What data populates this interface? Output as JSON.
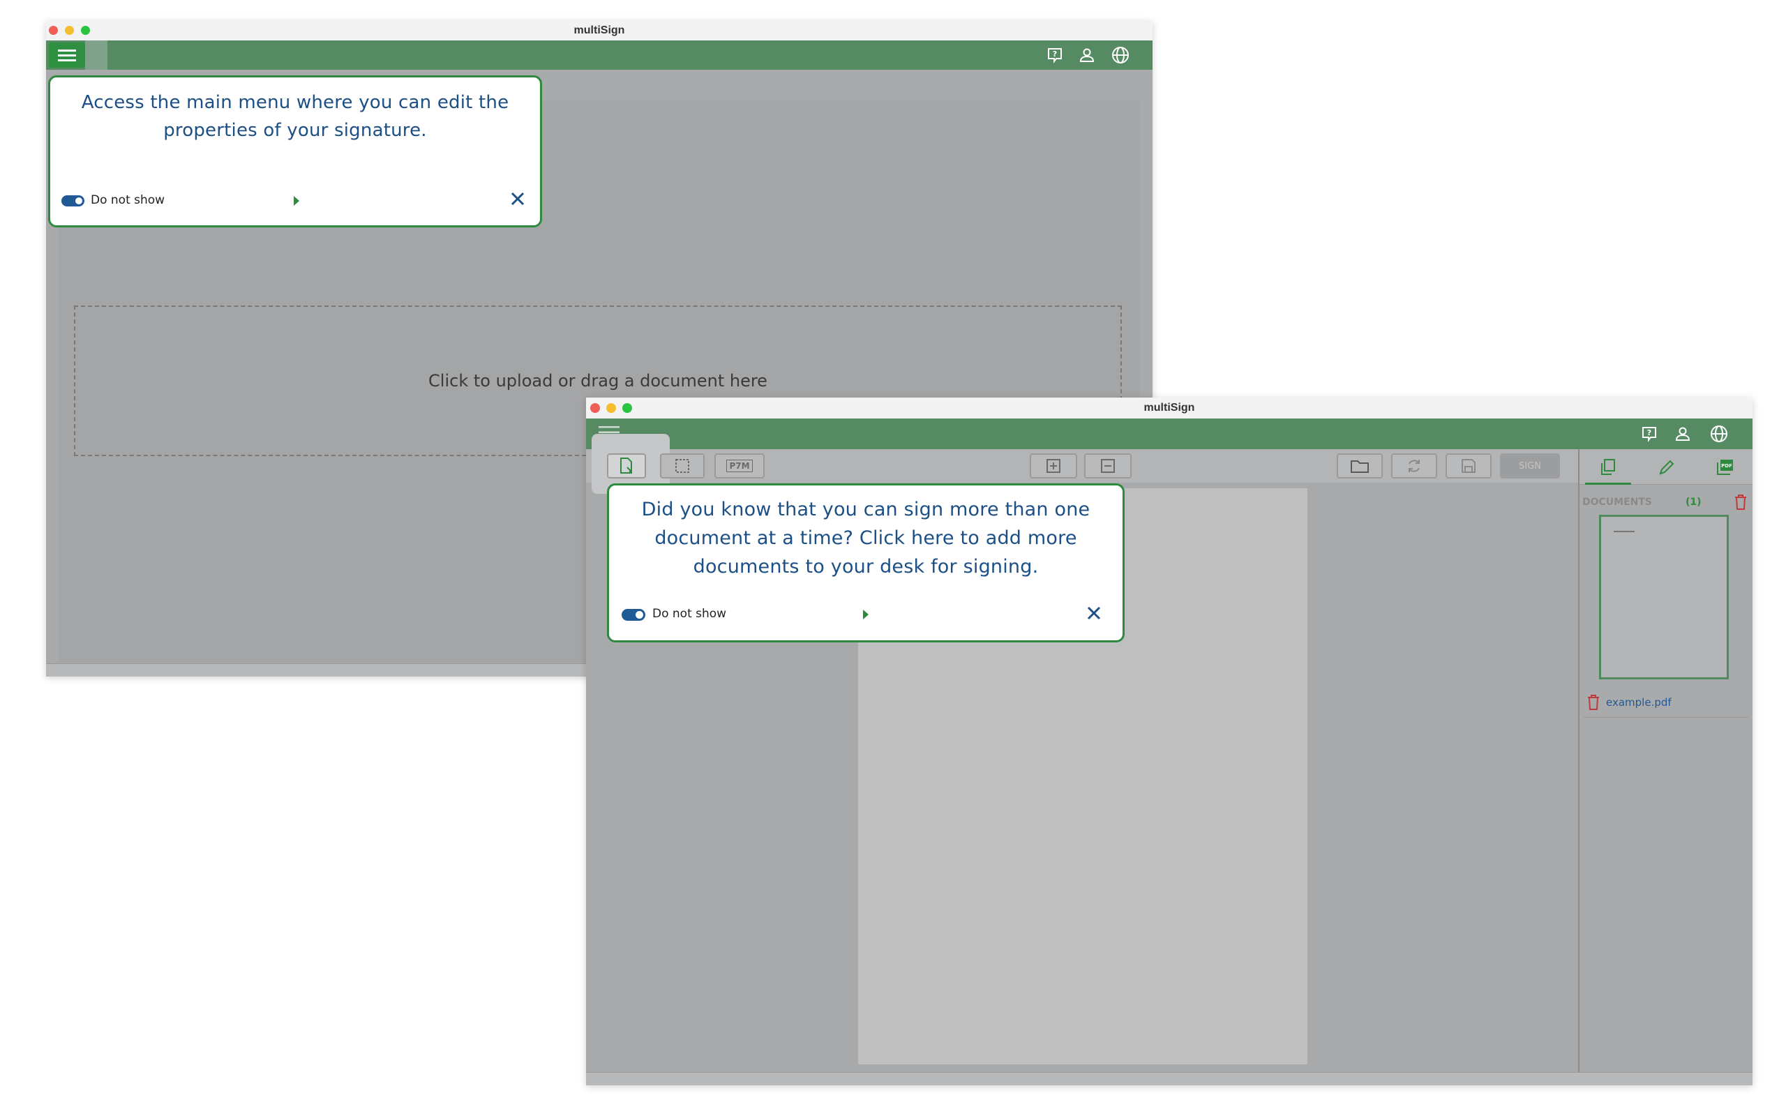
{
  "window_back": {
    "title": "multiSign",
    "dropzone_text": "Click to upload or drag a document here",
    "tooltip": {
      "message": "Access the main menu where you can edit the properties of your signature.",
      "do_not_show": "Do not show"
    }
  },
  "window_front": {
    "title": "multiSign",
    "toolbar": {
      "p7m_label": "P7M",
      "sign_label": "SIGN"
    },
    "tooltip": {
      "message": "Did you know that you can sign more than one document at a time? Click here to add more documents to your desk for signing.",
      "do_not_show": "Do not show"
    },
    "panel": {
      "documents_label": "DOCUMENTS",
      "documents_count": "(1)",
      "tab_pdf_label": "PDF",
      "file_name": "example.pdf"
    }
  },
  "colors": {
    "header_green": "#568a62",
    "accent_green": "#2e8a3f",
    "tooltip_text": "#1c4f86",
    "toggle_blue": "#1f5a96",
    "trash_red": "#c0393b"
  }
}
